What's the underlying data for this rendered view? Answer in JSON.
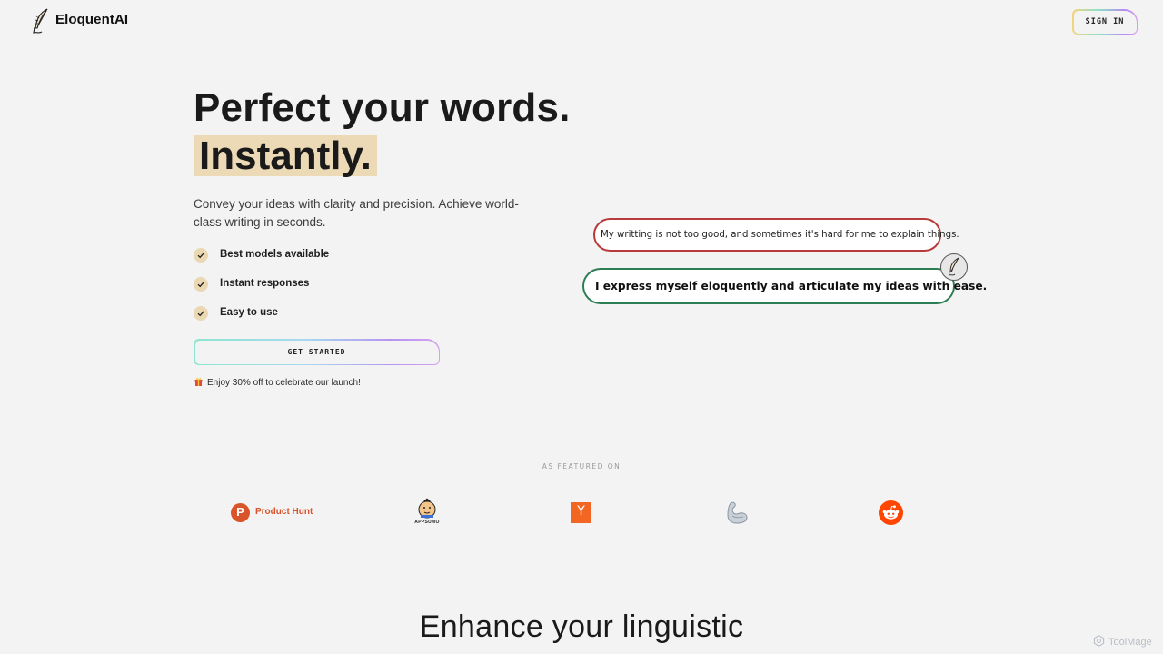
{
  "header": {
    "brand": "EloquentAI",
    "logo_icon": "quill-icon",
    "sign_in_label": "SIGN IN"
  },
  "hero": {
    "headline_line1": "Perfect your words.",
    "headline_line2": "Instantly.",
    "subtitle": "Convey your ideas with clarity and precision. Achieve world-class writing in seconds.",
    "features": [
      {
        "icon": "check-icon",
        "label": "Best models available"
      },
      {
        "icon": "check-icon",
        "label": "Instant responses"
      },
      {
        "icon": "check-icon",
        "label": "Easy to use"
      }
    ],
    "cta_label": "GET STARTED",
    "promo_icon": "gift-icon",
    "promo_text": "Enjoy 30% off to celebrate our launch!"
  },
  "demo": {
    "original_text": "My writting is not too good, and sometimes it's hard for me to explain things.",
    "improved_text": "I express myself eloquently and articulate my ideas with ease.",
    "avatar_icon": "quill-icon",
    "original_border_color": "#b83a3a",
    "improved_border_color": "#2d7d55"
  },
  "featured": {
    "label": "AS FEATURED ON",
    "logos": [
      {
        "name": "Product Hunt",
        "icon": "product-hunt-icon",
        "text": "Product Hunt",
        "letter": "P",
        "color": "#d9542b"
      },
      {
        "name": "AppSumo",
        "icon": "appsumo-icon",
        "text": "APPSUMO"
      },
      {
        "name": "Y Combinator",
        "icon": "y-combinator-icon",
        "letter": "Y",
        "color": "#f26522"
      },
      {
        "name": "Flexed arm",
        "icon": "flexed-arm-icon"
      },
      {
        "name": "Reddit",
        "icon": "reddit-icon",
        "color": "#ff4500"
      }
    ]
  },
  "section": {
    "heading": "Enhance your linguistic"
  },
  "watermark": {
    "text": "ToolMage"
  },
  "colors": {
    "background": "#f3f3f3",
    "highlight": "#ecd9b6",
    "check_bg": "#ead8b3"
  }
}
